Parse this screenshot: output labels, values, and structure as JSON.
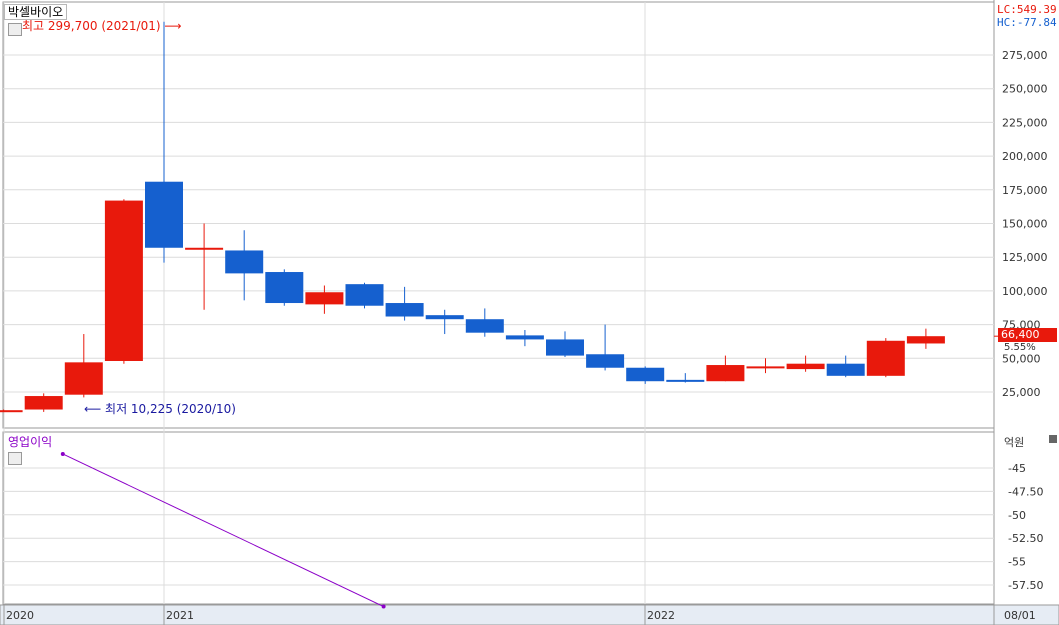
{
  "window": {
    "title": "박셀바이오",
    "lc_label": "LC:549.39",
    "hc_label": "HC:-77.84",
    "current_price_label": "66,400",
    "change_pct_label": "5.55%",
    "colors": {
      "up": "#e8190c",
      "down": "#1560cf",
      "indicator": "#8b00c8",
      "grid": "#dcdcdc",
      "max_anno": "#e8190c",
      "min_anno": "#1a1aa0"
    }
  },
  "annotations": {
    "max_label": "최고 299,700 (2021/01)",
    "min_label": "최저 10,225 (2020/10)"
  },
  "lower_pane": {
    "title": "영업이익",
    "unit": "억원"
  },
  "chart_data": [
    {
      "type": "candlestick",
      "title": "박셀바이오",
      "interval": "monthly",
      "ylim": [
        0,
        300000
      ],
      "yticks": [
        "25,000",
        "50,000",
        "75,000",
        "100,000",
        "125,000",
        "150,000",
        "175,000",
        "200,000",
        "225,000",
        "250,000",
        "275,000"
      ],
      "xticks": [
        "2020",
        "2021",
        "2022",
        "08/01"
      ],
      "candles": [
        {
          "x": "2020/09",
          "open": 11500,
          "high": 12000,
          "low": 11000,
          "close": 11500
        },
        {
          "x": "2020/10",
          "open": 12000,
          "high": 24000,
          "low": 10225,
          "close": 22000
        },
        {
          "x": "2020/11",
          "open": 23000,
          "high": 68000,
          "low": 21000,
          "close": 47000
        },
        {
          "x": "2020/12",
          "open": 48000,
          "high": 168000,
          "low": 46000,
          "close": 167000
        },
        {
          "x": "2021/01",
          "open": 181000,
          "high": 299700,
          "low": 121000,
          "close": 132000
        },
        {
          "x": "2021/02",
          "open": 131000,
          "high": 150000,
          "low": 86000,
          "close": 132000
        },
        {
          "x": "2021/03",
          "open": 130000,
          "high": 145000,
          "low": 93000,
          "close": 113000
        },
        {
          "x": "2021/04",
          "open": 114000,
          "high": 116000,
          "low": 89000,
          "close": 91000
        },
        {
          "x": "2021/05",
          "open": 90000,
          "high": 104000,
          "low": 83000,
          "close": 99000
        },
        {
          "x": "2021/06",
          "open": 105000,
          "high": 106000,
          "low": 87000,
          "close": 89000
        },
        {
          "x": "2021/07",
          "open": 91000,
          "high": 103000,
          "low": 78000,
          "close": 81000
        },
        {
          "x": "2021/08",
          "open": 82000,
          "high": 86000,
          "low": 68000,
          "close": 79000
        },
        {
          "x": "2021/09",
          "open": 79000,
          "high": 87000,
          "low": 66000,
          "close": 69000
        },
        {
          "x": "2021/10",
          "open": 67000,
          "high": 71000,
          "low": 59000,
          "close": 64000
        },
        {
          "x": "2021/11",
          "open": 64000,
          "high": 70000,
          "low": 51000,
          "close": 52000
        },
        {
          "x": "2021/12",
          "open": 53000,
          "high": 75000,
          "low": 41000,
          "close": 43000
        },
        {
          "x": "2022/01",
          "open": 43000,
          "high": 44000,
          "low": 31000,
          "close": 33000
        },
        {
          "x": "2022/02",
          "open": 34000,
          "high": 39000,
          "low": 32000,
          "close": 33000
        },
        {
          "x": "2022/03",
          "open": 33000,
          "high": 52000,
          "low": 33000,
          "close": 45000
        },
        {
          "x": "2022/04",
          "open": 44000,
          "high": 50000,
          "low": 39000,
          "close": 44000
        },
        {
          "x": "2022/05",
          "open": 42000,
          "high": 52000,
          "low": 40000,
          "close": 46000
        },
        {
          "x": "2022/06",
          "open": 46000,
          "high": 52000,
          "low": 36000,
          "close": 37000
        },
        {
          "x": "2022/07",
          "open": 37000,
          "high": 65000,
          "low": 36000,
          "close": 63000
        },
        {
          "x": "2022/08",
          "open": 61000,
          "high": 72000,
          "low": 57000,
          "close": 66400
        }
      ]
    },
    {
      "type": "line",
      "title": "영업이익",
      "ylabel": "억원",
      "ylim": [
        -60,
        -42
      ],
      "yticks": [
        "-45",
        "-47.50",
        "-50",
        "-52.50",
        "-55",
        "-57.50"
      ],
      "series": [
        {
          "name": "영업이익",
          "points": [
            {
              "x": "2020/11",
              "y": -43.5
            },
            {
              "x": "2021/07",
              "y": -59.8
            }
          ]
        }
      ]
    }
  ]
}
